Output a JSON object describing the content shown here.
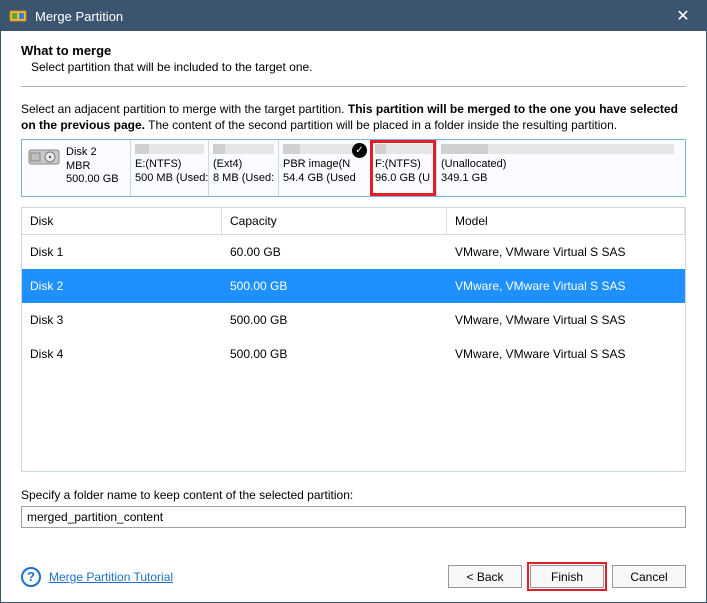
{
  "window": {
    "title": "Merge Partition"
  },
  "header": {
    "heading": "What to merge",
    "subheading": "Select partition that will be included to the target one."
  },
  "instruction": {
    "pre": "Select an adjacent partition to merge with the target partition. ",
    "bold": "This partition will be merged to the one you have selected on the previous page.",
    "post": " The content of the second partition will be placed in a folder inside the resulting partition."
  },
  "disk": {
    "name": "Disk 2",
    "type": "MBR",
    "size": "500.00 GB",
    "partitions": [
      {
        "label": "E:(NTFS)",
        "sub": "500 MB (Used:",
        "widthPx": 78,
        "checked": false,
        "highlight": false
      },
      {
        "label": "(Ext4)",
        "sub": "8 MB (Used: ",
        "widthPx": 70,
        "checked": false,
        "highlight": false
      },
      {
        "label": "PBR image(N",
        "sub": "54.4 GB (Used",
        "widthPx": 92,
        "checked": true,
        "highlight": false
      },
      {
        "label": "F:(NTFS)",
        "sub": "96.0 GB (U",
        "widthPx": 66,
        "checked": false,
        "highlight": true
      },
      {
        "label": "(Unallocated)",
        "sub": "349.1 GB",
        "widthPx": 242,
        "checked": false,
        "highlight": false
      }
    ]
  },
  "table": {
    "headers": {
      "disk": "Disk",
      "capacity": "Capacity",
      "model": "Model"
    },
    "rows": [
      {
        "disk": "Disk 1",
        "capacity": "60.00 GB",
        "model": "VMware, VMware Virtual S SAS",
        "selected": false
      },
      {
        "disk": "Disk 2",
        "capacity": "500.00 GB",
        "model": "VMware, VMware Virtual S SAS",
        "selected": true
      },
      {
        "disk": "Disk 3",
        "capacity": "500.00 GB",
        "model": "VMware, VMware Virtual S SAS",
        "selected": false
      },
      {
        "disk": "Disk 4",
        "capacity": "500.00 GB",
        "model": "VMware, VMware Virtual S SAS",
        "selected": false
      }
    ]
  },
  "folder": {
    "label": "Specify a folder name to keep content of the selected partition:",
    "value": "merged_partition_content"
  },
  "footer": {
    "tutorial": "Merge Partition Tutorial",
    "back": "< Back",
    "finish": "Finish",
    "cancel": "Cancel"
  }
}
